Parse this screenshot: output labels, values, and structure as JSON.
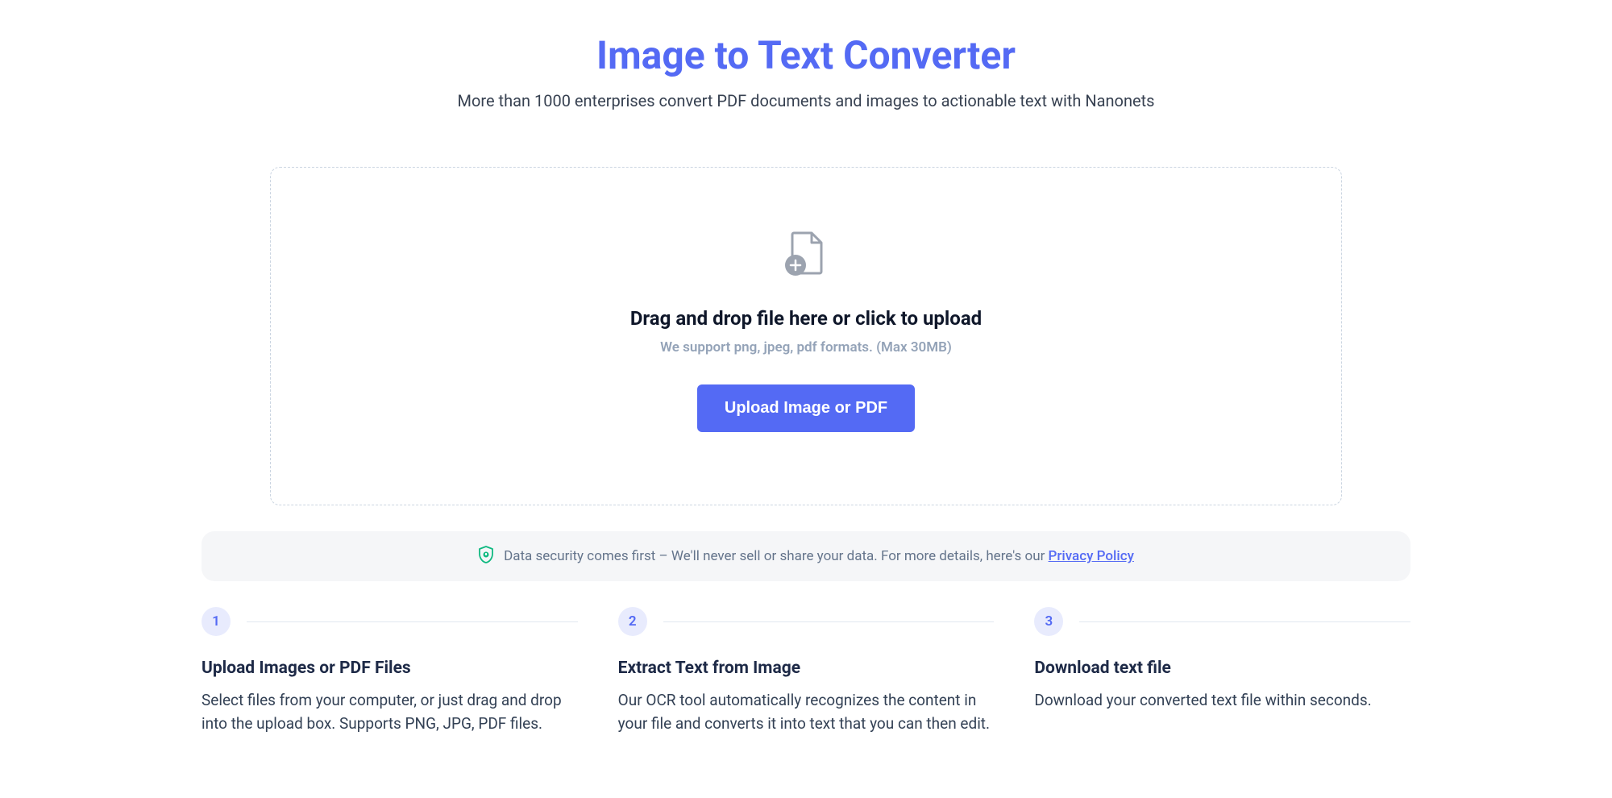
{
  "header": {
    "title": "Image to Text Converter",
    "subtitle": "More than 1000 enterprises convert PDF documents and images to actionable text with Nanonets"
  },
  "upload": {
    "heading": "Drag and drop file here or click to upload",
    "subtext": "We support png, jpeg, pdf formats. (Max 30MB)",
    "button_label": "Upload Image or PDF"
  },
  "security": {
    "text": "Data security comes first – We'll never sell or share your data. For more details, here's our ",
    "link_text": "Privacy Policy"
  },
  "steps": [
    {
      "number": "1",
      "title": "Upload Images or PDF Files",
      "description": "Select files from your computer, or just drag and drop into the upload box. Supports PNG, JPG, PDF files."
    },
    {
      "number": "2",
      "title": "Extract Text from Image",
      "description": "Our OCR tool automatically recognizes the content in your file and converts it into text that you can then edit."
    },
    {
      "number": "3",
      "title": "Download text file",
      "description": "Download your converted text file within seconds."
    }
  ]
}
